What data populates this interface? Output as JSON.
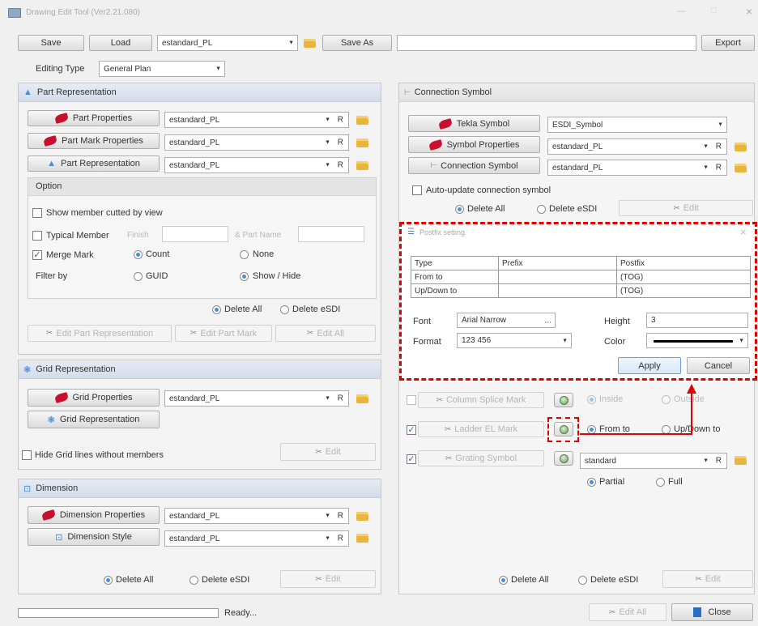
{
  "window": {
    "title": "Drawing Edit Tool (Ver2.21.080)",
    "min_label": "—",
    "max_label": "□",
    "close_label": "×"
  },
  "toolbar": {
    "save": "Save",
    "load": "Load",
    "preset": "estandard_PL",
    "save_as": "Save As",
    "save_as_value": "",
    "export": "Export"
  },
  "editing_type": {
    "label": "Editing Type",
    "value": "General Plan"
  },
  "part_rep": {
    "title": "Part Representation",
    "rows": [
      {
        "button": "Part Properties",
        "value": "estandard_PL",
        "r": "R"
      },
      {
        "button": "Part Mark Properties",
        "value": "estandard_PL",
        "r": "R"
      },
      {
        "button": "Part Representation",
        "value": "estandard_PL",
        "r": "R"
      }
    ],
    "option": {
      "title": "Option",
      "show_member": "Show member cutted by view",
      "typical_member": "Typical Member",
      "finish": "Finish",
      "part_name": "& Part Name",
      "merge_mark": "Merge Mark",
      "count": "Count",
      "none": "None",
      "filter_by": "Filter by",
      "guid": "GUID",
      "show_hide": "Show / Hide"
    },
    "delete_all": "Delete All",
    "delete_esdi": "Delete eSDI",
    "edit_part_rep": "Edit Part Representation",
    "edit_part_mark": "Edit Part Mark",
    "edit_all": "Edit All"
  },
  "grid_rep": {
    "title": "Grid Representation",
    "grid_properties": "Grid Properties",
    "grid_value": "estandard_PL",
    "r": "R",
    "grid_representation": "Grid Representation",
    "hide_lines": "Hide Grid lines without members",
    "edit": "Edit"
  },
  "dimension": {
    "title": "Dimension",
    "props": "Dimension Properties",
    "props_value": "estandard_PL",
    "style": "Dimension Style",
    "style_value": "estandard_PL",
    "r": "R",
    "delete_all": "Delete All",
    "delete_esdi": "Delete eSDI",
    "edit": "Edit"
  },
  "connection": {
    "title": "Connection Symbol",
    "tekla_symbol": "Tekla Symbol",
    "tekla_value": "ESDI_Symbol",
    "symbol_props": "Symbol Properties",
    "symbol_value": "estandard_PL",
    "conn_symbol": "Connection Symbol",
    "conn_value": "estandard_PL",
    "r": "R",
    "auto_update": "Auto-update connection symbol",
    "delete_all": "Delete All",
    "delete_esdi": "Delete eSDI",
    "edit": "Edit"
  },
  "marks": {
    "column_splice": "Column Splice Mark",
    "inside": "Inside",
    "outside": "Outside",
    "ladder_el": "Ladder EL Mark",
    "from_to": "From to",
    "up_down_to": "Up/Down to",
    "grating": "Grating Symbol",
    "grating_value": "standard",
    "r": "R",
    "partial": "Partial",
    "full": "Full",
    "delete_all": "Delete All",
    "delete_esdi": "Delete eSDI",
    "edit": "Edit"
  },
  "postfix": {
    "title": "Postfix setting",
    "close": "×",
    "headers": [
      "Type",
      "Prefix",
      "Postfix"
    ],
    "rows": [
      [
        "From to",
        "",
        "(TOG)"
      ],
      [
        "Up/Down to",
        "",
        "(TOG)"
      ]
    ],
    "font_label": "Font",
    "font_value": "Arial Narrow",
    "font_more": "...",
    "height_label": "Height",
    "height_value": "3",
    "format_label": "Format",
    "format_value": "123 456",
    "color_label": "Color",
    "apply": "Apply",
    "cancel": "Cancel"
  },
  "footer": {
    "status": "Ready...",
    "progress": 0,
    "edit_all": "Edit All",
    "close": "Close"
  },
  "colors": {
    "highlight_red": "#e00000",
    "accent_blue": "#2b6ab5"
  }
}
